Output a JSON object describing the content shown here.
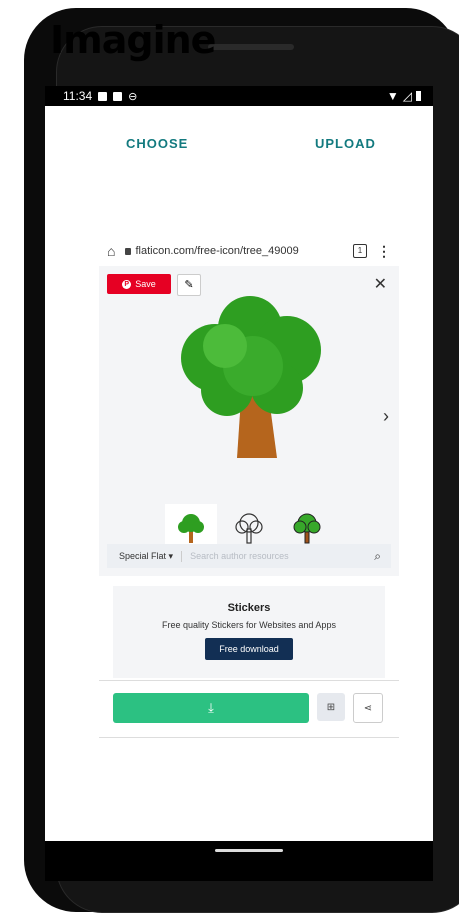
{
  "overlay_title": "Imagine",
  "status": {
    "time": "11:34",
    "icons_left": [
      "sim-icon",
      "notification-icon",
      "sync-icon"
    ],
    "icons_right": [
      "wifi-icon",
      "signal-icon",
      "battery-icon"
    ]
  },
  "tabs": {
    "choose": "CHOOSE",
    "upload": "UPLOAD"
  },
  "browser": {
    "url": "flaticon.com/free-icon/tree_49009",
    "tab_count": "1"
  },
  "viewer": {
    "save_label": "Save",
    "pin_symbol": "P",
    "close_symbol": "✕",
    "next_symbol": "›"
  },
  "search": {
    "style_select": "Special Flat",
    "placeholder": "Search author resources"
  },
  "promo": {
    "title": "Stickers",
    "description": "Free quality Stickers for Websites and Apps",
    "button": "Free download"
  },
  "colors": {
    "accent": "#137a7f",
    "download": "#2cc182",
    "pinterest": "#e60023",
    "tree_green": "#2e9e21",
    "trunk": "#b5651d"
  }
}
